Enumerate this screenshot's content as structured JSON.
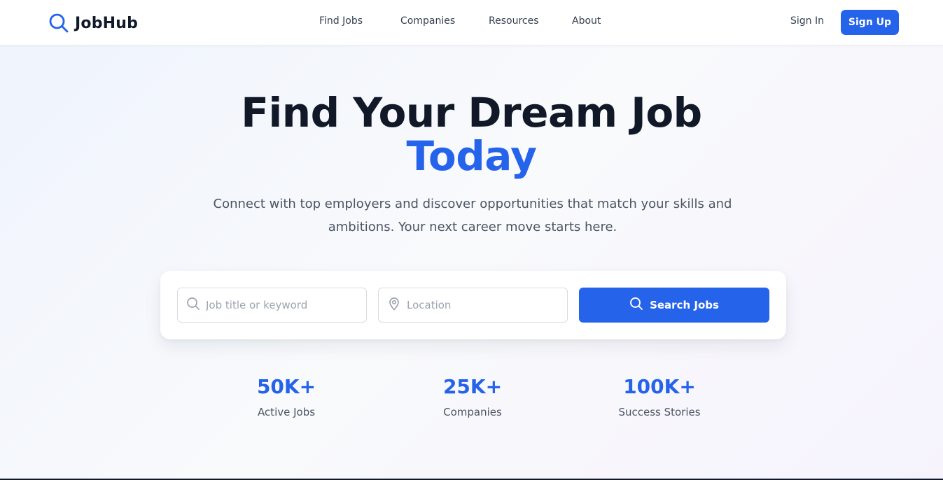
{
  "brand": {
    "name": "JobHub",
    "logo_icon": "search-icon",
    "accent": "#2563eb"
  },
  "nav": {
    "links": [
      "Find Jobs",
      "Companies",
      "Resources",
      "About"
    ],
    "sign_in": "Sign In",
    "sign_up": "Sign Up"
  },
  "hero": {
    "title": "Find Your Dream Job",
    "title_accent": "Today",
    "subtitle": "Connect with top employers and discover opportunities that match your skills and ambitions. Your next career move starts here."
  },
  "search": {
    "keyword_placeholder": "Job title or keyword",
    "keyword_value": "",
    "keyword_icon": "search-icon",
    "location_placeholder": "Location",
    "location_value": "",
    "location_icon": "map-pin-icon",
    "button_label": "Search Jobs",
    "button_icon": "search-icon"
  },
  "stats": [
    {
      "value": "50K+",
      "label": "Active Jobs"
    },
    {
      "value": "25K+",
      "label": "Companies"
    },
    {
      "value": "100K+",
      "label": "Success Stories"
    }
  ]
}
